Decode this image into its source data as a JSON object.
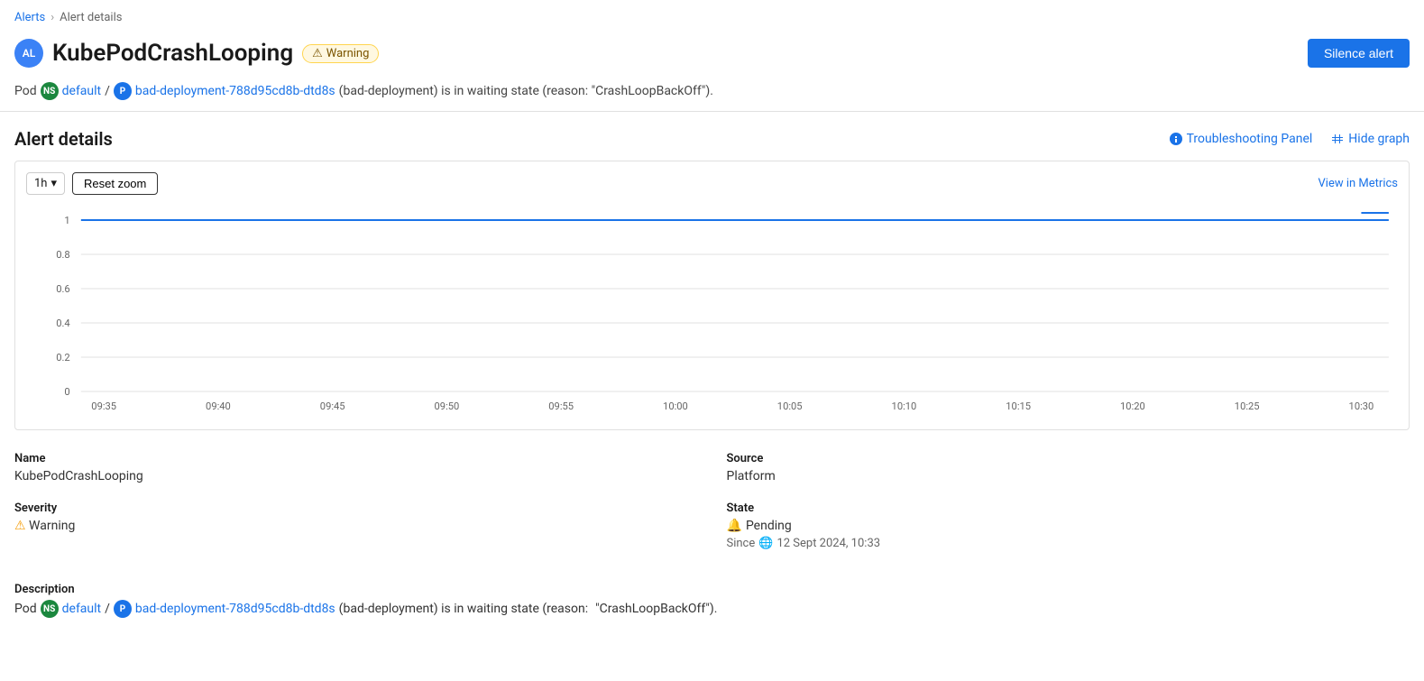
{
  "breadcrumb": {
    "alerts_label": "Alerts",
    "current_label": "Alert details"
  },
  "header": {
    "avatar_text": "AL",
    "alert_name": "KubePodCrashLooping",
    "warning_badge_icon": "⚠",
    "warning_badge_label": "Warning",
    "silence_button_label": "Silence alert"
  },
  "pod_line": {
    "prefix": "Pod",
    "ns_badge": "NS",
    "ns_link_text": "default",
    "separator": "/",
    "pod_badge": "P",
    "pod_link_text": "bad-deployment-788d95cd8b-dtd8s",
    "description": "(bad-deployment) is in waiting state (reason: \"CrashLoopBackOff\")."
  },
  "alert_details": {
    "title": "Alert details",
    "troubleshooting_panel_label": "Troubleshooting Panel",
    "hide_graph_label": "Hide graph"
  },
  "chart": {
    "time_select_value": "1h",
    "reset_zoom_label": "Reset zoom",
    "view_metrics_label": "View in Metrics",
    "y_axis": [
      1,
      0.8,
      0.6,
      0.4,
      0.2,
      0
    ],
    "x_axis": [
      "09:35",
      "09:40",
      "09:45",
      "09:50",
      "09:55",
      "10:00",
      "10:05",
      "10:10",
      "10:15",
      "10:20",
      "10:25",
      "10:30"
    ]
  },
  "details": {
    "name_label": "Name",
    "name_value": "KubePodCrashLooping",
    "source_label": "Source",
    "source_value": "Platform",
    "severity_label": "Severity",
    "severity_icon": "⚠",
    "severity_value": "Warning",
    "state_label": "State",
    "state_icon": "🔔",
    "state_value": "Pending",
    "since_label": "Since",
    "since_icon": "🌐",
    "since_value": "12 Sept 2024, 10:33",
    "description_label": "Description",
    "description_prefix": "Pod",
    "ns_badge": "NS",
    "ns_link_text": "default",
    "separator": "/",
    "pod_badge": "P",
    "pod_link_text": "bad-deployment-788d95cd8b-dtd8s",
    "description_suffix": "(bad-deployment) is in waiting state (reason:",
    "description_reason": "\"CrashLoopBackOff\")."
  }
}
